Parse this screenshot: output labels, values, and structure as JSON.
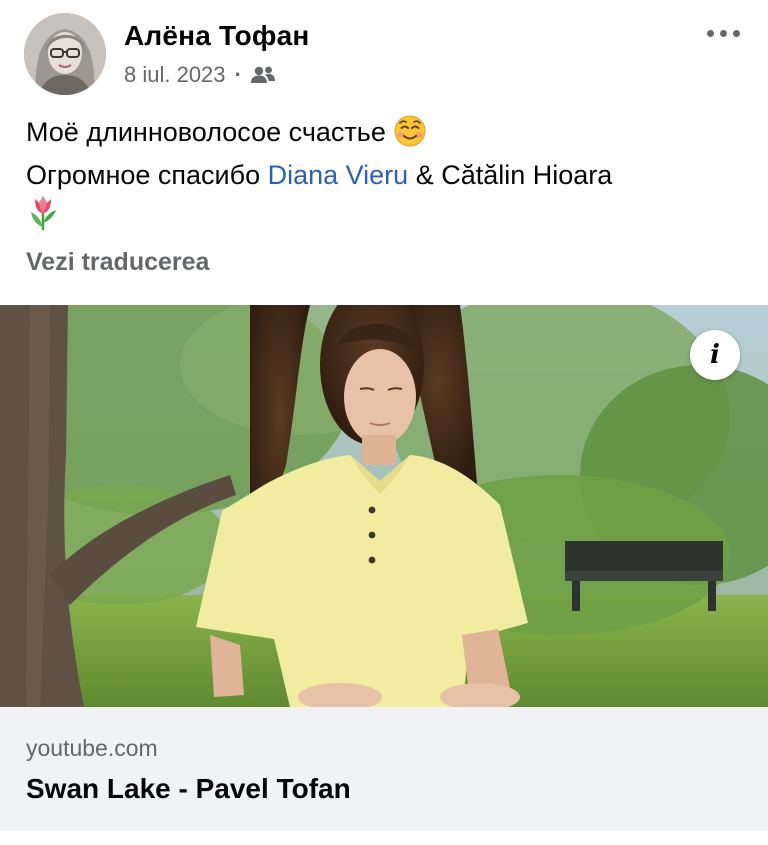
{
  "post": {
    "author": "Алёна Тофан",
    "date": "8 iul. 2023",
    "separator": "·",
    "audience_icon": "friends-icon",
    "more_icon": "more-options-icon",
    "text_line1": "Моё длинноволосое счастье",
    "text_line1_emoji": "smiling-face-emoji",
    "text_line2_prefix": "Огромное спасибо ",
    "mention": "Diana Vieru",
    "text_line2_suffix": " & Cătălin Hioara",
    "text_line3_emoji": "tulip-emoji",
    "see_translation": "Vezi traducerea"
  },
  "media": {
    "overlay_icon": "info-icon",
    "info_glyph": "i"
  },
  "link_card": {
    "domain": "youtube.com",
    "title": "Swan Lake - Pavel Tofan"
  },
  "colors": {
    "text_primary": "#050505",
    "text_secondary": "#65676b",
    "mention": "#2d5fb5",
    "card_background": "#f0f2f5"
  }
}
